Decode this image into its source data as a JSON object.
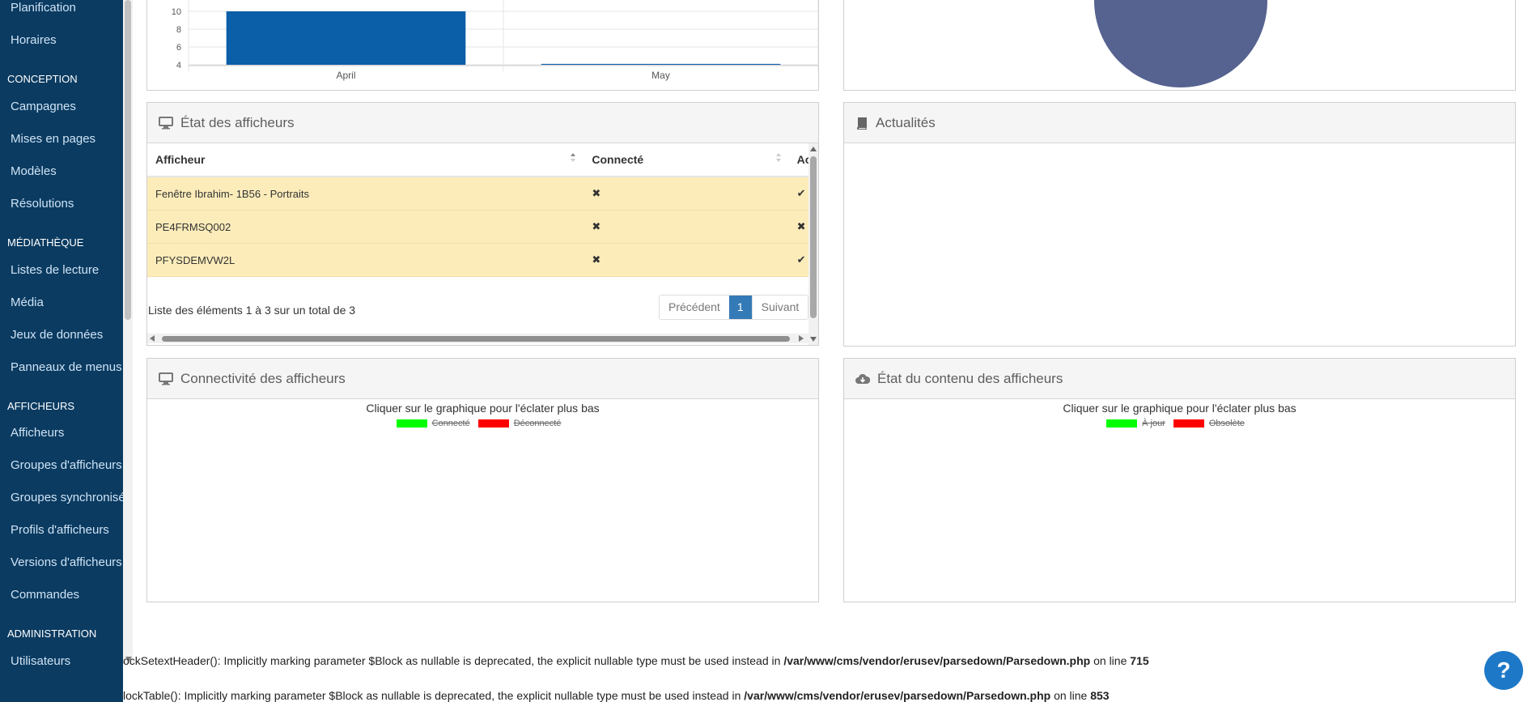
{
  "sidebar": {
    "sections": [
      {
        "label": "CONCEPTION",
        "items": [
          "Campagnes",
          "Mises en pages",
          "Modèles",
          "Résolutions"
        ]
      },
      {
        "label": "MÉDIATHÈQUE",
        "items": [
          "Listes de lecture",
          "Média",
          "Jeux de données",
          "Panneaux de menus"
        ]
      },
      {
        "label": "AFFICHEURS",
        "items": [
          "Afficheurs",
          "Groupes d'afficheurs",
          "Groupes synchronisés",
          "Profils d'afficheurs",
          "Versions d'afficheurs",
          "Commandes"
        ]
      },
      {
        "label": "ADMINISTRATION",
        "items": [
          "Utilisateurs"
        ]
      }
    ],
    "top_items": [
      "Planification",
      "Horaires"
    ]
  },
  "chart_data": {
    "type": "bar",
    "categories": [
      "April",
      "May"
    ],
    "values": [
      10,
      4.1
    ],
    "y_ticks": [
      "4",
      "6",
      "8",
      "10"
    ],
    "ylim": [
      4,
      10
    ],
    "title": "",
    "xlabel": "",
    "ylabel": ""
  },
  "colors": {
    "sidebar_bg": "#0b3b61",
    "bar": "#0b5ea8",
    "pie": "#566391",
    "connected": "#00ff00",
    "disconnected": "#ff0000",
    "row_bg": "#fcecba",
    "pager_active": "#337ab7"
  },
  "display_status": {
    "title": "État des afficheurs",
    "columns": [
      "Afficheur",
      "Connecté",
      "Activé"
    ],
    "rows": [
      {
        "name": "Fenêtre Ibrahim- 1B56 - Portraits",
        "connected": "✖",
        "active": "✔"
      },
      {
        "name": "PE4FRMSQ002",
        "connected": "✖",
        "active": "✖"
      },
      {
        "name": "PFYSDEMVW2L",
        "connected": "✖",
        "active": "✔"
      }
    ],
    "info": "Liste des éléments 1 à 3 sur un total de 3",
    "pager": {
      "prev": "Précédent",
      "page": "1",
      "next": "Suivant"
    }
  },
  "news": {
    "title": "Actualités"
  },
  "connectivity": {
    "title": "Connectivité des afficheurs",
    "hint": "Cliquer sur le graphique pour l'éclater plus bas",
    "legend": [
      "Connecté",
      "Déconnecté"
    ]
  },
  "content_status": {
    "title": "État du contenu des afficheurs",
    "hint": "Cliquer sur le graphique pour l'éclater plus bas",
    "legend": [
      "À jour",
      "Obsolète"
    ]
  },
  "notices": [
    {
      "pre": "ockSetextHeader(): Implicitly marking parameter $Block as nullable is deprecated, the explicit nullable type must be used instead in ",
      "path": "/var/www/cms/vendor/erusev/parsedown/Parsedown.php",
      "mid": " on line ",
      "line": "715"
    },
    {
      "pre": "lockTable(): Implicitly marking parameter $Block as nullable is deprecated, the explicit nullable type must be used instead in ",
      "path": "/var/www/cms/vendor/erusev/parsedown/Parsedown.php",
      "mid": " on line ",
      "line": "853"
    }
  ],
  "help": {
    "label": "?"
  }
}
